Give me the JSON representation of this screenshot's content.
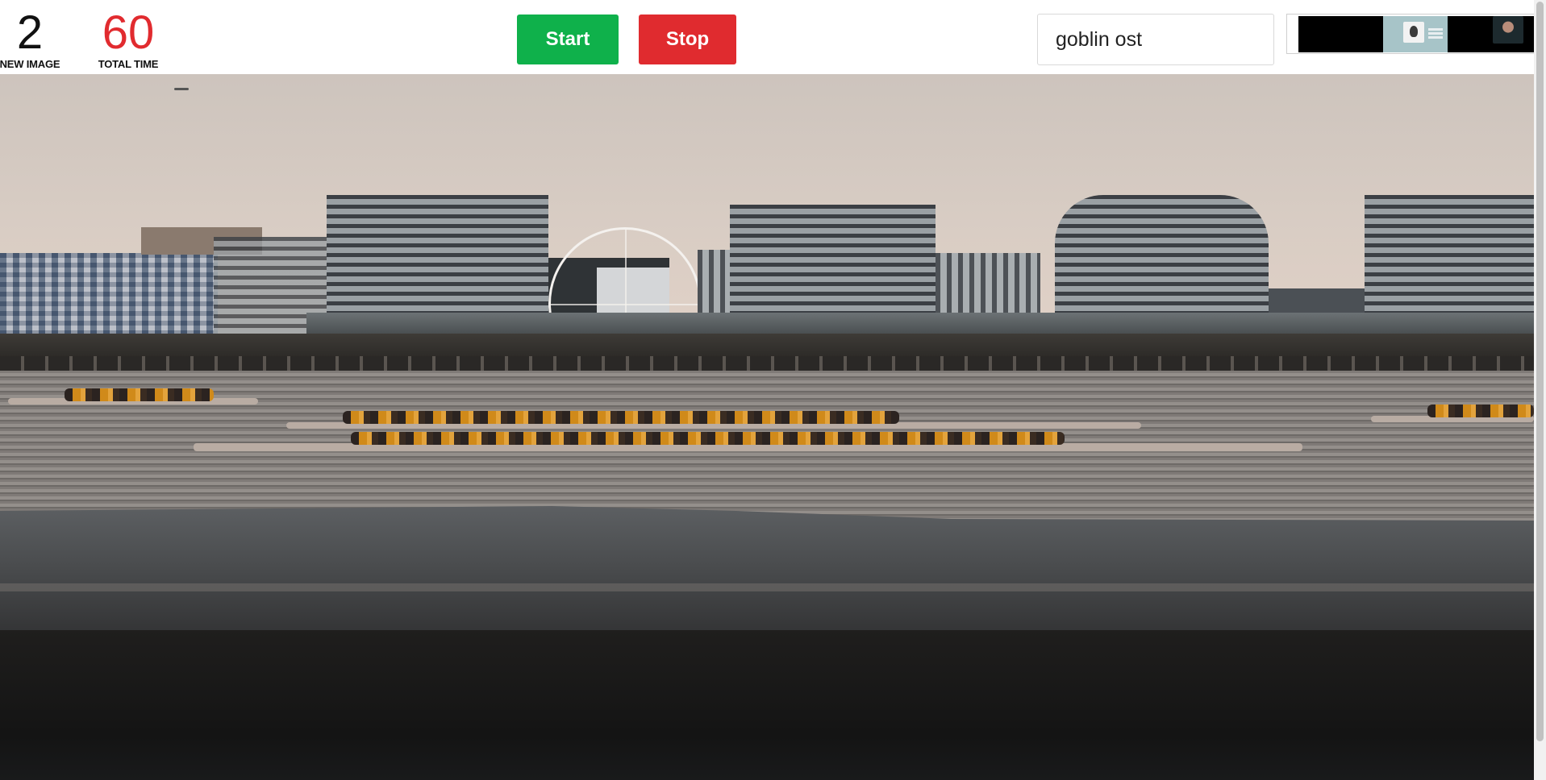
{
  "counters": {
    "images": {
      "value": "2",
      "label": "NEW IMAGE"
    },
    "time": {
      "value": "60",
      "label": "TOTAL TIME"
    }
  },
  "controls": {
    "start_label": "Start",
    "stop_label": "Stop"
  },
  "search": {
    "value": "goblin ost"
  },
  "colors": {
    "start": "#0fb14b",
    "stop": "#e02b2f",
    "time_value": "#e12b2f"
  },
  "preview": {
    "icons": [
      "profile-card-thumbnail",
      "avatar-thumbnail"
    ]
  },
  "photo": {
    "subject": "waterfront-skyline-with-dragon-boats"
  }
}
